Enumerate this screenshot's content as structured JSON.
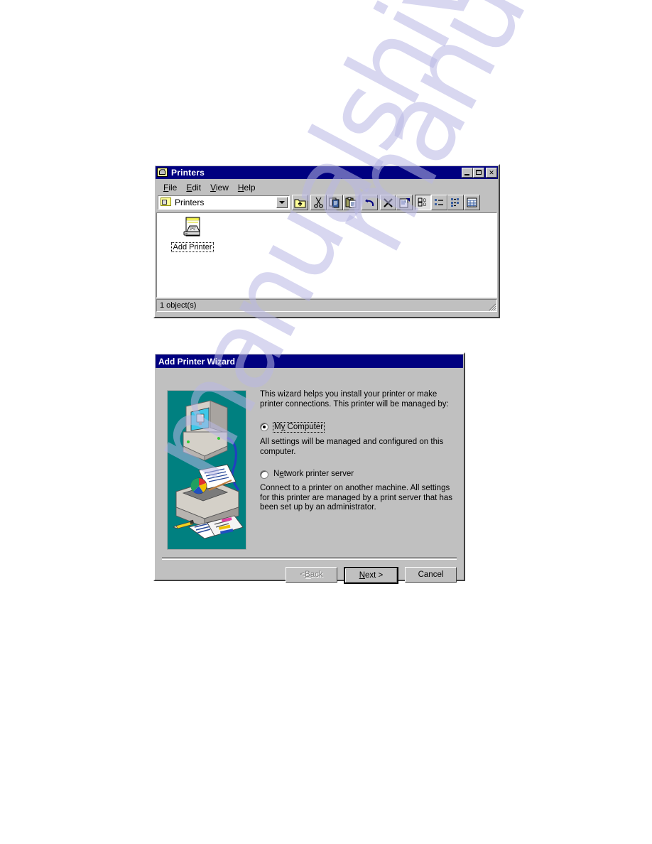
{
  "watermark": {
    "line1": "manualshive",
    "line2": "manualshive.com"
  },
  "explorer": {
    "title": "Printers",
    "title_icon": "printers-folder-icon",
    "window_buttons": {
      "minimize": "minimize-icon",
      "maximize": "maximize-icon",
      "close": "close-icon",
      "close_label": "✕"
    },
    "menu": [
      {
        "label": "File",
        "accel": "F"
      },
      {
        "label": "Edit",
        "accel": "E"
      },
      {
        "label": "View",
        "accel": "V"
      },
      {
        "label": "Help",
        "accel": "H"
      }
    ],
    "address": {
      "value": "Printers",
      "icon": "printers-folder-icon"
    },
    "toolbar": [
      {
        "name": "up-one-level-button",
        "icon": "folder-up-icon"
      },
      {
        "name": "cut-button",
        "icon": "scissors-icon"
      },
      {
        "name": "copy-button",
        "icon": "copy-icon"
      },
      {
        "name": "paste-button",
        "icon": "clipboard-paste-icon"
      },
      {
        "name": "undo-button",
        "icon": "undo-arrow-icon"
      },
      {
        "name": "delete-button",
        "icon": "x-delete-icon"
      },
      {
        "name": "properties-button",
        "icon": "properties-icon"
      },
      {
        "name": "large-icons-view-button",
        "icon": "large-icons-icon"
      },
      {
        "name": "small-icons-view-button",
        "icon": "small-icons-icon"
      },
      {
        "name": "list-view-button",
        "icon": "list-view-icon"
      },
      {
        "name": "details-view-button",
        "icon": "details-view-icon"
      }
    ],
    "items": [
      {
        "label": "Add Printer",
        "icon": "add-printer-icon",
        "selected": true
      }
    ],
    "status": "1 object(s)"
  },
  "wizard": {
    "title": "Add Printer Wizard",
    "intro": "This wizard helps you install your printer or make printer connections.  This printer will be managed by:",
    "options": [
      {
        "label_pre": "M",
        "label_accel": "y",
        "label_post": " Computer",
        "label_full": "My Computer",
        "checked": true,
        "focused": true,
        "description": "All settings will be managed and configured on this computer."
      },
      {
        "label_pre": "N",
        "label_accel": "e",
        "label_post": "twork printer server",
        "label_full": "Network printer server",
        "checked": false,
        "focused": false,
        "description": "Connect to a printer on another machine.  All settings for this printer are managed by a print server that has been set up by an administrator."
      }
    ],
    "buttons": {
      "back": "< Back",
      "back_pre": "< ",
      "back_accel": "B",
      "back_post": "ack",
      "next": "Next >",
      "next_pre": "",
      "next_accel": "N",
      "next_post": "ext >",
      "cancel": "Cancel"
    },
    "illustration": {
      "name": "printer-computer-illustration",
      "background_color": "#008080"
    }
  },
  "colors": {
    "titlebar_active": "#000080",
    "face": "#c0c0c0",
    "teal": "#008080",
    "watermark": "#b9b8e4"
  }
}
